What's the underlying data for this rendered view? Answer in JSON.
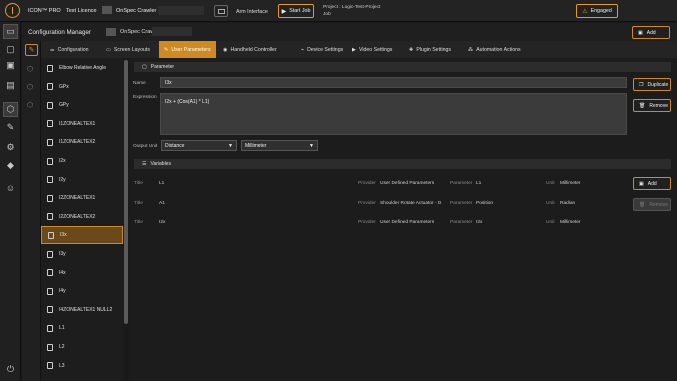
{
  "topbar": {
    "brand": "ICON™ PRO",
    "licence": "Test Licence",
    "crawler": "OnSpec Crawler",
    "arm_interface": "Arm Interface",
    "start_job": "Start Job",
    "project": "Project : Logic-Test-Project",
    "job": "Job",
    "engaged": "Engaged"
  },
  "config": {
    "title": "Configuration Manager",
    "crawler": "OnSpec Crawler",
    "add": "Add"
  },
  "tabs": [
    {
      "label": "Configuration",
      "icon": "sliders-icon"
    },
    {
      "label": "Screen Layouts",
      "icon": "monitor-icon"
    },
    {
      "label": "User Parameters",
      "icon": "pencil-icon"
    },
    {
      "label": "Handheld Controller",
      "icon": "gamepad-icon"
    },
    {
      "label": "Device Settings",
      "icon": "plug-icon"
    },
    {
      "label": "Video Settings",
      "icon": "video-icon"
    },
    {
      "label": "Plugin Settings",
      "icon": "puzzle-icon"
    },
    {
      "label": "Automation Actions",
      "icon": "nodes-icon"
    }
  ],
  "params_list": [
    "Elbow Relative Angle",
    "GPx",
    "GPy",
    "I1ZONEALTEX1",
    "I1ZONEALTEX2",
    "I2x",
    "I2y",
    "I2ZONEALTEX1",
    "I2ZONEALTEX2",
    "I3x",
    "I3y",
    "I4x",
    "I4y",
    "I4ZONEALTEX1 NULL2",
    "L1",
    "L2",
    "L3",
    "RULE1CHECK"
  ],
  "selected_index": 9,
  "parameter": {
    "section": "Parameter",
    "name_label": "Name",
    "name_value": "I3x",
    "expr_label": "Expression",
    "expr_value": "I2x + (Cos(A1) * L1)",
    "unit_label": "Output Unit",
    "unit_type": "Distance",
    "unit_value": "Millimeter",
    "duplicate": "Duplicate",
    "remove": "Remove"
  },
  "variables": {
    "section": "Variables",
    "add": "Add",
    "remove": "Remove",
    "col_title": "Title",
    "col_provider": "Provider",
    "col_parameter": "Parameter",
    "col_unit": "Unit",
    "rows": [
      {
        "title": "L1",
        "provider": "User Defined Parameters",
        "parameter": "L1",
        "unit": "Millimeter"
      },
      {
        "title": "A1",
        "provider": "Shoulder Rotate Actuator - D",
        "parameter": "Position",
        "unit": "Radian"
      },
      {
        "title": "I2x",
        "provider": "User Defined Parameters",
        "parameter": "I2x",
        "unit": "Millimeter"
      }
    ]
  }
}
